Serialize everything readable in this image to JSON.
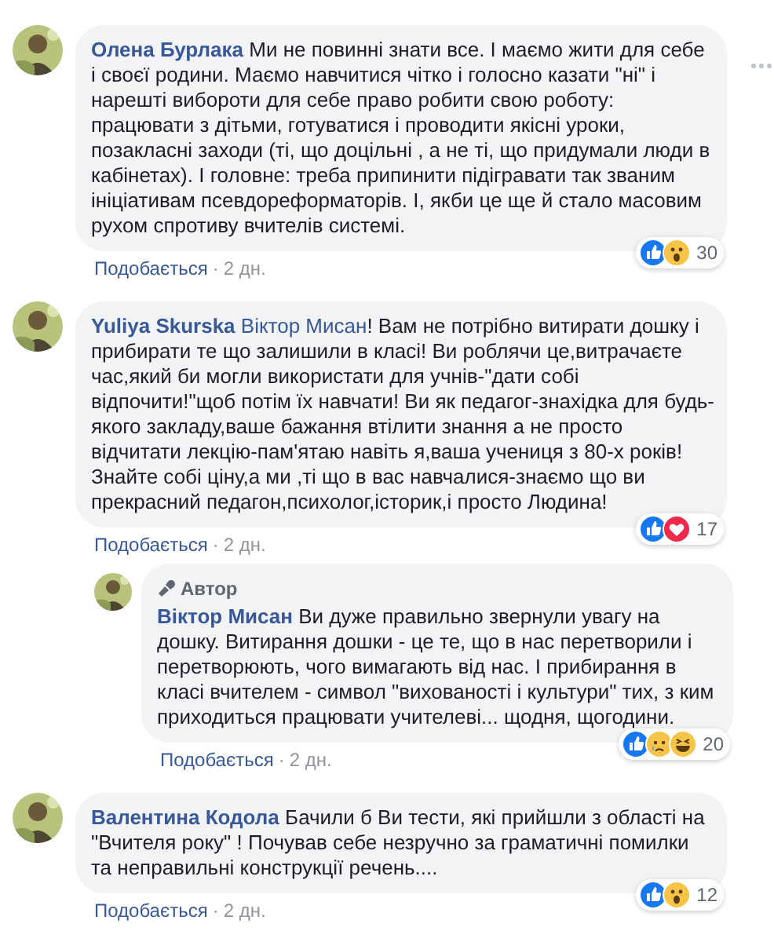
{
  "comments": [
    {
      "author": "Олена Бурлака",
      "text": "Ми не повинні знати все. І маємо жити для себе і своєї родини. Маємо навчитися чітко і голосно казати \"ні\" і нарешті вибороти для себе право робити свою роботу: працювати з дітьми, готуватися і проводити якісні уроки, позакласні заходи (ті, що доцільні , а не ті, що придумали люди в кабінетах). І головне: треба припинити підігравати так званим ініціативам псевдореформаторів. І, якби це ще й стало масовим рухом спротиву вчителів системі.",
      "menu_visible": true,
      "reactions": [
        {
          "kind": "like"
        },
        {
          "kind": "wow"
        }
      ],
      "reaction_count": "30",
      "like_label": "Подобається",
      "separator": "·",
      "time": "2 дн."
    },
    {
      "author": "Yuliya Skurska",
      "mention": "Віктор Мисан",
      "text": "! Вам не потрібно витирати дошку і прибирати те що залишили в класі! Ви роблячи це,витрачаєте час,який би могли використати для учнів-\"дати собі відпочити!\"щоб потім їх навчати! Ви як педагог-знахідка для будь-якого закладу,ваше бажання втілити знання а не просто відчитати лекцію-пам'ятаю навіть я,ваша учениця з 80-х років! Знайте собі ціну,а ми ,ті що в вас навчалися-знаємо що ви прекрасний педагон,психолог,історик,і просто Людина!",
      "menu_visible": false,
      "reactions": [
        {
          "kind": "like"
        },
        {
          "kind": "love"
        }
      ],
      "reaction_count": "17",
      "like_label": "Подобається",
      "separator": "·",
      "time": "2 дн.",
      "children": [
        {
          "badge": "Автор",
          "author": "Віктор Мисан",
          "text": "Ви дуже правильно звернули увагу на дошку. Витирання дошки - це те, що в нас перетворили і перетворюють, чого вимагають від нас. І прибирання в класі вчителем - символ \"вихованості і культури\" тих, з ким приходиться працювати учителеві... щодня, щогодини.",
          "menu_visible": false,
          "reactions": [
            {
              "kind": "like"
            },
            {
              "kind": "sad"
            },
            {
              "kind": "haha"
            }
          ],
          "reaction_count": "20",
          "like_label": "Подобається",
          "separator": "·",
          "time": "2 дн."
        }
      ]
    },
    {
      "author": "Валентина Кодола",
      "text": "Бачили б Ви тести, які прийшли з області на \"Вчителя року\" ! Почував себе незручно за граматичні помилки та неправильні конструкції речень....",
      "menu_visible": false,
      "reactions": [
        {
          "kind": "like"
        },
        {
          "kind": "wow"
        }
      ],
      "reaction_count": "12",
      "like_label": "Подобається",
      "separator": "·",
      "time": "2 дн."
    }
  ]
}
